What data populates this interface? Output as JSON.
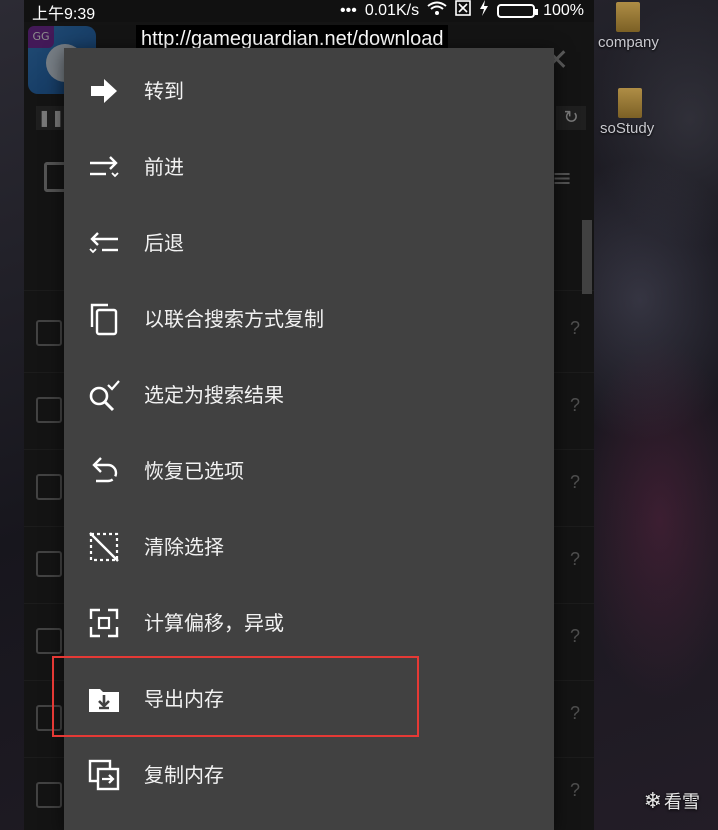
{
  "status_bar": {
    "time": "上午9:39",
    "dots": "•••",
    "net_speed": "0.01K/s",
    "battery_percent": "100%",
    "battery_level": 1.0
  },
  "app": {
    "logo_badge": "GG",
    "url": "http://gameguardian.net/download"
  },
  "desktop_icons": [
    {
      "label": "company"
    },
    {
      "label": "soStudy"
    }
  ],
  "menu": {
    "items": [
      {
        "label": "转到",
        "icon": "arrow-right-icon"
      },
      {
        "label": "前进",
        "icon": "forward-icon"
      },
      {
        "label": "后退",
        "icon": "back-icon"
      },
      {
        "label": "以联合搜索方式复制",
        "icon": "copy-icon"
      },
      {
        "label": "选定为搜索结果",
        "icon": "search-check-icon"
      },
      {
        "label": "恢复已选项",
        "icon": "undo-icon"
      },
      {
        "label": "清除选择",
        "icon": "clear-selection-icon"
      },
      {
        "label": "计算偏移，异或",
        "icon": "offset-calc-icon"
      },
      {
        "label": "导出内存",
        "icon": "export-memory-icon"
      },
      {
        "label": "复制内存",
        "icon": "copy-memory-icon"
      }
    ]
  },
  "list_rows": [
    {
      "mark": "?"
    },
    {
      "mark": "?"
    },
    {
      "mark": "?"
    },
    {
      "mark": "?"
    },
    {
      "mark": "?"
    },
    {
      "mark": "?"
    },
    {
      "mark": "?"
    }
  ],
  "watermark": {
    "text": "看雪",
    "icon": "snowflake-icon"
  },
  "colors": {
    "highlight": "#e53935",
    "menu_bg": "#414141",
    "battery": "#3bd16f"
  }
}
